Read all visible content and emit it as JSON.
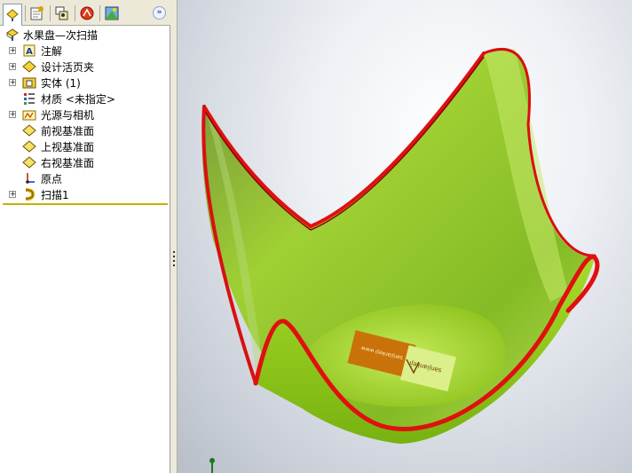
{
  "feature_tree": {
    "root": {
      "label": "水果盘—次扫描",
      "icon": "part-icon"
    },
    "items": [
      {
        "label": "注解",
        "icon": "annotations-icon",
        "expandable": true
      },
      {
        "label": "设计活页夹",
        "icon": "design-binder-icon",
        "expandable": true
      },
      {
        "label": "实体 (1)",
        "icon": "solid-bodies-icon",
        "expandable": true
      },
      {
        "label": "材质 <未指定>",
        "icon": "material-icon",
        "expandable": false
      },
      {
        "label": "光源与相机",
        "icon": "lights-cameras-icon",
        "expandable": true
      },
      {
        "label": "前视基准面",
        "icon": "plane-icon",
        "expandable": false
      },
      {
        "label": "上视基准面",
        "icon": "plane-icon",
        "expandable": false
      },
      {
        "label": "右视基准面",
        "icon": "plane-icon",
        "expandable": false
      },
      {
        "label": "原点",
        "icon": "origin-icon",
        "expandable": false
      },
      {
        "label": "扫描1",
        "icon": "sweep-icon",
        "expandable": true
      }
    ],
    "expander_glyph": "+"
  },
  "tabs": [
    {
      "name": "featuremanager-tab",
      "icon": "featuremanager-icon",
      "active": true
    },
    {
      "name": "propertymanager-tab",
      "icon": "propertymanager-icon",
      "active": false
    },
    {
      "name": "configurationmanager-tab",
      "icon": "configuration-icon",
      "active": false
    },
    {
      "name": "dimxpert-tab",
      "icon": "dimxpert-icon",
      "active": false
    },
    {
      "name": "display-manager-tab",
      "icon": "display-manager-icon",
      "active": false
    }
  ],
  "expand_button_label": "»",
  "decal": {
    "left_text": "sanjiankeji\nwww",
    "right_text": "sanjiankeji"
  },
  "colors": {
    "model_green": "#8fd11a",
    "model_rim": "#e01010",
    "decal_orange": "#c9720a",
    "rollback_bar": "#c6b100"
  }
}
